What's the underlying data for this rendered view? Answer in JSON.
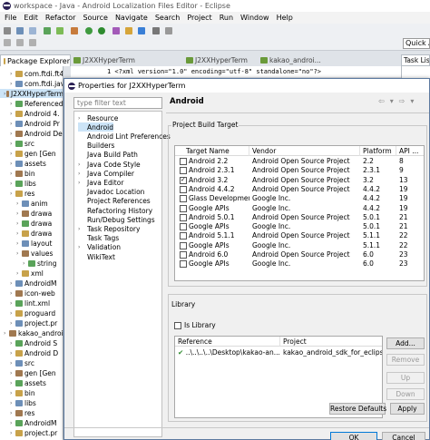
{
  "window": {
    "title": "workspace - Java - Android Localization Files Editor - Eclipse"
  },
  "menu": [
    "File",
    "Edit",
    "Refactor",
    "Source",
    "Navigate",
    "Search",
    "Project",
    "Run",
    "Window",
    "Help"
  ],
  "quick_access": "Quick A",
  "package_explorer": {
    "tab_label": "Package Explorer",
    "rows": [
      {
        "text": "com.ftdi.ft42",
        "indent": 1
      },
      {
        "text": "com.ftdi.java",
        "indent": 1
      },
      {
        "text": "J2XXHyperTerm",
        "indent": 0,
        "selected": true
      },
      {
        "text": "Referenced",
        "indent": 1
      },
      {
        "text": "Android 4.",
        "indent": 1
      },
      {
        "text": "Android Pr",
        "indent": 1
      },
      {
        "text": "Android De",
        "indent": 1
      },
      {
        "text": "src",
        "indent": 1
      },
      {
        "text": "gen [Gen",
        "indent": 1
      },
      {
        "text": "assets",
        "indent": 1
      },
      {
        "text": "bin",
        "indent": 1
      },
      {
        "text": "libs",
        "indent": 1
      },
      {
        "text": "res",
        "indent": 1
      },
      {
        "text": "anim",
        "indent": 2
      },
      {
        "text": "drawa",
        "indent": 2
      },
      {
        "text": "drawa",
        "indent": 2
      },
      {
        "text": "drawa",
        "indent": 2
      },
      {
        "text": "layout",
        "indent": 2
      },
      {
        "text": "values",
        "indent": 2
      },
      {
        "text": "string",
        "indent": 3
      },
      {
        "text": "xml",
        "indent": 2
      },
      {
        "text": "AndroidM",
        "indent": 1
      },
      {
        "text": "icon-web",
        "indent": 1
      },
      {
        "text": "lint.xml",
        "indent": 1
      },
      {
        "text": "proguard",
        "indent": 1
      },
      {
        "text": "project.pr",
        "indent": 1
      },
      {
        "text": "kakao_android",
        "indent": 0
      },
      {
        "text": "Android S",
        "indent": 1
      },
      {
        "text": "Android D",
        "indent": 1
      },
      {
        "text": "src",
        "indent": 1
      },
      {
        "text": "gen [Gen",
        "indent": 1
      },
      {
        "text": "assets",
        "indent": 1
      },
      {
        "text": "bin",
        "indent": 1
      },
      {
        "text": "libs",
        "indent": 1
      },
      {
        "text": "res",
        "indent": 1
      },
      {
        "text": "AndroidM",
        "indent": 1
      },
      {
        "text": "project.pr",
        "indent": 1
      }
    ]
  },
  "editor": {
    "tabs": [
      "J2XXHyperTerm",
      "J2XXHyperTerm",
      "kakao_androi..."
    ],
    "line": "1 <?xml version=\"1.0\" encoding=\"utf-8\" standalone=\"no\"?>"
  },
  "task_list": {
    "tab_label": "Task Lis"
  },
  "dialog": {
    "title": "Properties for J2XXHyperTerm",
    "filter_placeholder": "type filter text",
    "nav": [
      {
        "label": "Resource",
        "caret": true
      },
      {
        "label": "Android",
        "selected": true
      },
      {
        "label": "Android Lint Preferences"
      },
      {
        "label": "Builders"
      },
      {
        "label": "Java Build Path"
      },
      {
        "label": "Java Code Style",
        "caret": true
      },
      {
        "label": "Java Compiler",
        "caret": true
      },
      {
        "label": "Java Editor",
        "caret": true
      },
      {
        "label": "Javadoc Location"
      },
      {
        "label": "Project References"
      },
      {
        "label": "Refactoring History"
      },
      {
        "label": "Run/Debug Settings"
      },
      {
        "label": "Task Repository",
        "caret": true
      },
      {
        "label": "Task Tags"
      },
      {
        "label": "Validation",
        "caret": true
      },
      {
        "label": "WikiText"
      }
    ],
    "page_title": "Android",
    "build_target": {
      "group_label": "Project Build Target",
      "columns": [
        "Target Name",
        "Vendor",
        "Platform",
        "API ..."
      ],
      "rows": [
        {
          "name": "Android 2.2",
          "vendor": "Android Open Source Project",
          "platform": "2.2",
          "api": "8",
          "checked": false
        },
        {
          "name": "Android 2.3.1",
          "vendor": "Android Open Source Project",
          "platform": "2.3.1",
          "api": "9",
          "checked": false
        },
        {
          "name": "Android 3.2",
          "vendor": "Android Open Source Project",
          "platform": "3.2",
          "api": "13",
          "checked": true
        },
        {
          "name": "Android 4.4.2",
          "vendor": "Android Open Source Project",
          "platform": "4.4.2",
          "api": "19",
          "checked": false
        },
        {
          "name": "Glass Developmen...",
          "vendor": "Google Inc.",
          "platform": "4.4.2",
          "api": "19",
          "checked": false
        },
        {
          "name": "Google APIs",
          "vendor": "Google Inc.",
          "platform": "4.4.2",
          "api": "19",
          "checked": false
        },
        {
          "name": "Android 5.0.1",
          "vendor": "Android Open Source Project",
          "platform": "5.0.1",
          "api": "21",
          "checked": false
        },
        {
          "name": "Google APIs",
          "vendor": "Google Inc.",
          "platform": "5.0.1",
          "api": "21",
          "checked": false
        },
        {
          "name": "Android 5.1.1",
          "vendor": "Android Open Source Project",
          "platform": "5.1.1",
          "api": "22",
          "checked": false
        },
        {
          "name": "Google APIs",
          "vendor": "Google Inc.",
          "platform": "5.1.1",
          "api": "22",
          "checked": false
        },
        {
          "name": "Android 6.0",
          "vendor": "Android Open Source Project",
          "platform": "6.0",
          "api": "23",
          "checked": false
        },
        {
          "name": "Google APIs",
          "vendor": "Google Inc.",
          "platform": "6.0",
          "api": "23",
          "checked": false
        }
      ]
    },
    "library": {
      "group_label": "Library",
      "is_library_label": "Is Library",
      "columns": [
        "Reference",
        "Project"
      ],
      "rows": [
        {
          "reference": "..\\..\\..\\..\\Desktop\\kakao-an...",
          "project": "kakao_android_sdk_for_eclipse"
        }
      ],
      "buttons": {
        "add": "Add...",
        "remove": "Remove",
        "up": "Up",
        "down": "Down"
      }
    },
    "buttons": {
      "restore": "Restore Defaults",
      "apply": "Apply",
      "ok": "OK",
      "cancel": "Cancel"
    }
  }
}
